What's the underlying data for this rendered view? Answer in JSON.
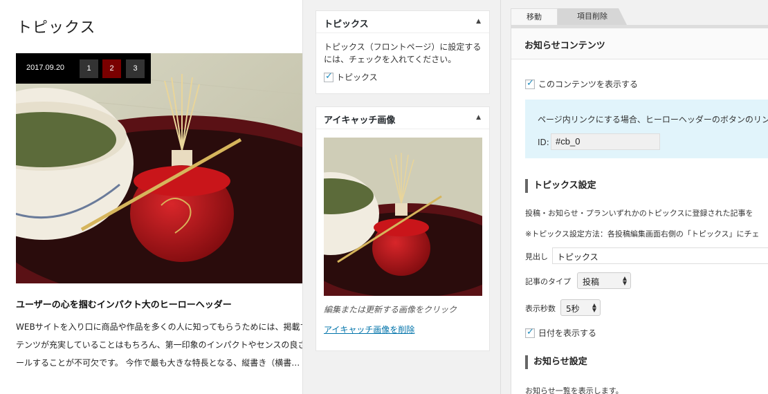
{
  "preview": {
    "title": "トピックス",
    "date": "2017.09.20",
    "pages": [
      "1",
      "2",
      "3"
    ],
    "active_page": "2",
    "article_title": "ユーザーの心を掴むインパクト大のヒーローヘッダー",
    "article_body": "WEBサイトを入り口に商品や作品を多くの人に知ってもらうためには、掲載するコンテンツが充実していることはもちろん、第一印象のインパクトやセンスの良さをアピールすることが不可欠です。 今作で最も大きな特長となる、縦書き（横書…"
  },
  "topics_box": {
    "title": "トピックス",
    "description": "トピックス（フロントページ）に設定するには、チェックを入れてください。",
    "checkbox_label": "トピックス"
  },
  "eyecatch_box": {
    "title": "アイキャッチ画像",
    "hint": "編集または更新する画像をクリック",
    "remove_link": "アイキャッチ画像を削除"
  },
  "right": {
    "tab_move": "移動",
    "tab_delete": "項目削除",
    "panel_title": "お知らせコンテンツ",
    "show_content_label": "このコンテンツを表示する",
    "info_text": "ページ内リンクにする場合、ヒーローヘッダーのボタンのリンク",
    "id_label": "ID:",
    "id_value": "#cb_0",
    "topics_section_title": "トピックス設定",
    "topics_desc1": "投稿・お知らせ・プランいずれかのトピックスに登録された記事を",
    "topics_desc2": "※トピックス設定方法：各投稿編集画面右側の「トピックス」にチェ",
    "heading_label": "見出し",
    "heading_value": "トピックス",
    "type_label": "記事のタイプ",
    "type_value": "投稿",
    "seconds_label": "表示秒数",
    "seconds_value": "5秒",
    "show_date_label": "日付を表示する",
    "news_section_title": "お知らせ設定",
    "news_desc": "お知らせ一覧を表示します。"
  }
}
